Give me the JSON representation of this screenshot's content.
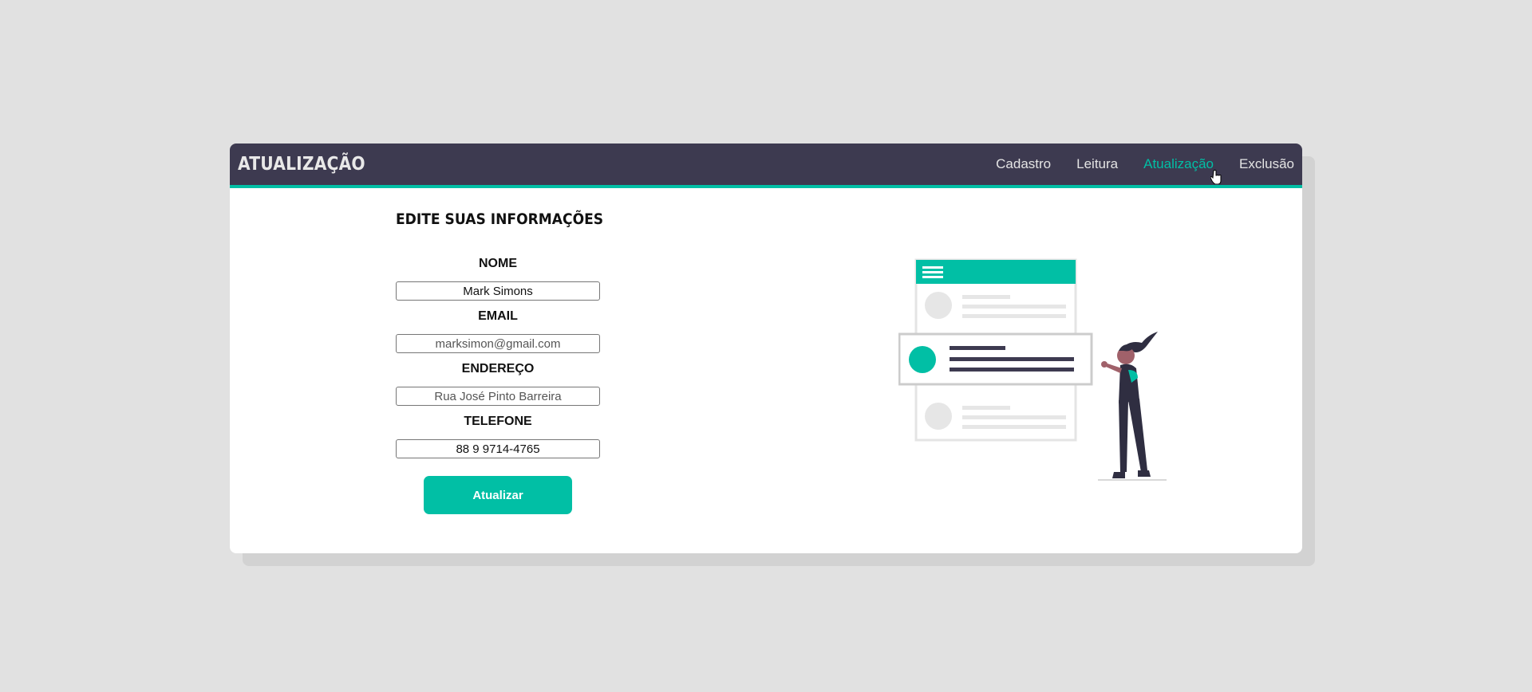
{
  "header": {
    "title": "ATUALIZAÇÃO",
    "nav": [
      {
        "label": "Cadastro"
      },
      {
        "label": "Leitura"
      },
      {
        "label": "Atualização"
      },
      {
        "label": "Exclusão"
      }
    ]
  },
  "form": {
    "title": "EDITE SUAS INFORMAÇÕES",
    "fields": [
      {
        "label": "NOME",
        "value": "Mark Simons"
      },
      {
        "label": "EMAIL",
        "value": "marksimon@gmail.com"
      },
      {
        "label": "ENDEREÇO",
        "value": "Rua José Pinto Barreira"
      },
      {
        "label": "TELEFONE",
        "value": "88 9 9714-4765"
      }
    ],
    "submit_label": "Atualizar"
  },
  "colors": {
    "accent": "#01bfa5",
    "navbar": "#3d3a50",
    "background": "#e1e1e1"
  },
  "icons": {
    "illustration": "person-updating-list-illustration",
    "cursor": "hand-pointer-cursor"
  }
}
